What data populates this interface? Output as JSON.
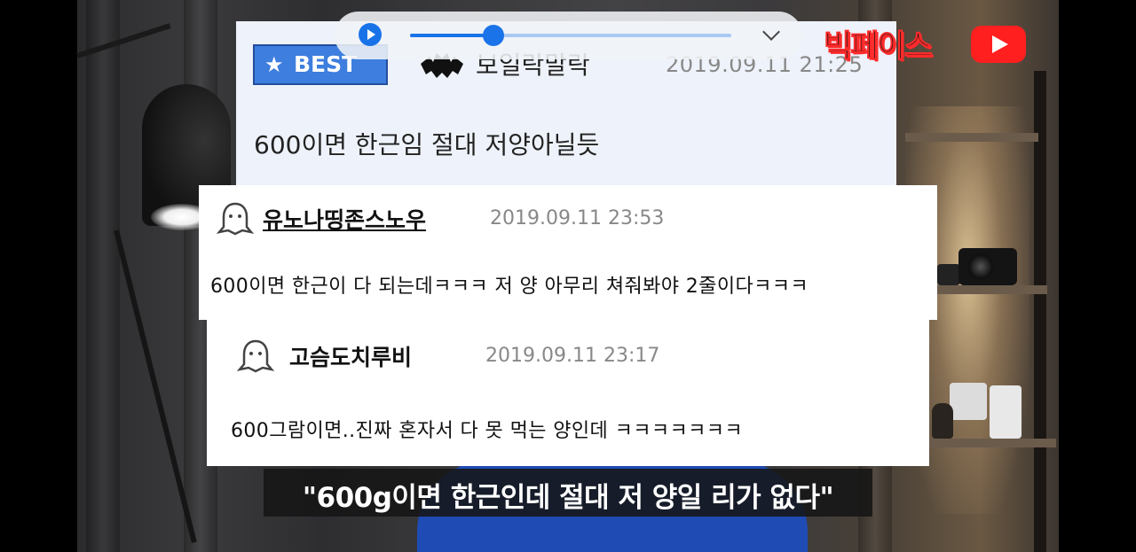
{
  "player": {
    "progress": 0.26,
    "accent_color": "#1a73e8",
    "play_icon": "play-icon",
    "collapse_icon": "chevron-down-icon"
  },
  "channel_logo": {
    "text": "빅페이스",
    "icon": "youtube-play-icon"
  },
  "comments": [
    {
      "badge": "BEST",
      "avatar_icon": "bat-icon",
      "author": "보일락말락",
      "date": "2019.09.11 21:25",
      "text": "600이면 한근임 절대 저양아닐듯"
    },
    {
      "avatar_icon": "ghost-icon",
      "author": "유노나띵존스노우",
      "date": "2019.09.11 23:53",
      "text": "600이면 한근이 다 되는데ㅋㅋㅋ 저 양 아무리 쳐줘봐야 2줄이다ㅋㅋㅋ"
    },
    {
      "avatar_icon": "ghost-icon",
      "author": "고슴도치루비",
      "date": "2019.09.11 23:17",
      "text": "600그람이면..진짜 혼자서 다 못 먹는 양인데 ㅋㅋㅋㅋㅋㅋㅋ"
    }
  ],
  "subtitle": "\"600g이면 한근인데 절대 저 양일 리가 없다\""
}
